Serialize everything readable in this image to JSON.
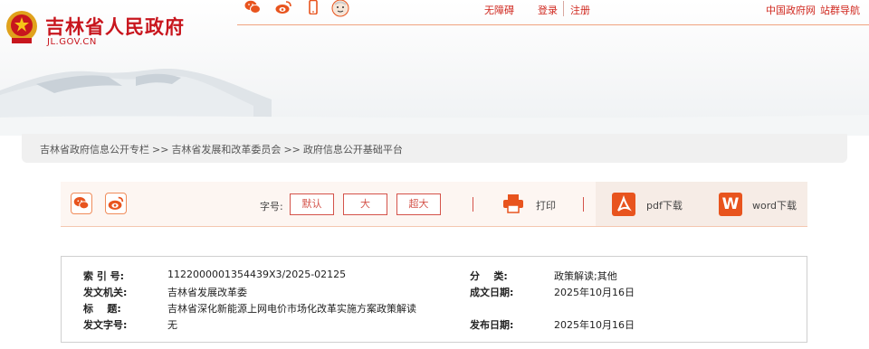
{
  "header": {
    "site_title": "吉林省人民政府",
    "site_domain": "JL.GOV.CN",
    "links": {
      "accessibility": "无障碍",
      "login": "登录",
      "register": "注册",
      "china_gov": "中国政府网",
      "site_nav": "站群导航"
    }
  },
  "breadcrumb": {
    "items": [
      "吉林省政府信息公开专栏",
      "吉林省发展和改革委员会",
      "政府信息公开基础平台"
    ],
    "separator": ">>"
  },
  "toolbar": {
    "font_size_label": "字号:",
    "font_default": "默认",
    "font_large": "大",
    "font_xlarge": "超大",
    "print": "打印",
    "pdf_download": "pdf下载",
    "word_download": "word下载",
    "word_icon_letter": "W"
  },
  "info": {
    "index_label": "索 引 号:",
    "index_value": "1122000001354439X3/2025-02125",
    "category_label": "分    类:",
    "category_value": "政策解读;其他",
    "issuer_label": "发文机关:",
    "issuer_value": "吉林省发展改革委",
    "created_label": "成文日期:",
    "created_value": "2025年10月16日",
    "title_label": "标    题:",
    "title_value": "吉林省深化新能源上网电价市场化改革实施方案政策解读",
    "docno_label": "发文字号:",
    "docno_value": "无",
    "published_label": "发布日期:",
    "published_value": "2025年10月16日"
  },
  "icons": [
    "emblem-icon",
    "wechat-icon",
    "weibo-icon",
    "mobile-icon",
    "elderly-mode-icon",
    "printer-icon",
    "pdf-icon",
    "word-icon"
  ],
  "colors": {
    "brand_red": "#c8161e",
    "accent_orange": "#f08c5a"
  }
}
